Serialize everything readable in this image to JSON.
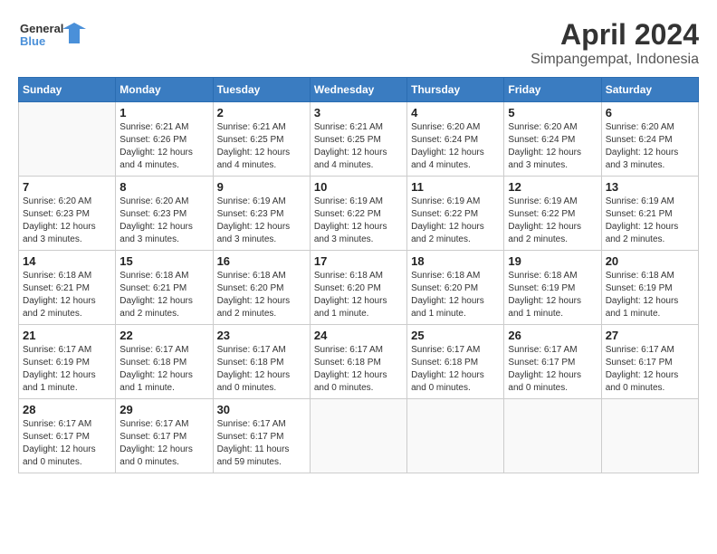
{
  "header": {
    "logo_line1": "General",
    "logo_line2": "Blue",
    "title": "April 2024",
    "subtitle": "Simpangempat, Indonesia"
  },
  "calendar": {
    "days_of_week": [
      "Sunday",
      "Monday",
      "Tuesday",
      "Wednesday",
      "Thursday",
      "Friday",
      "Saturday"
    ],
    "weeks": [
      [
        {
          "day": "",
          "info": ""
        },
        {
          "day": "1",
          "info": "Sunrise: 6:21 AM\nSunset: 6:26 PM\nDaylight: 12 hours\nand 4 minutes."
        },
        {
          "day": "2",
          "info": "Sunrise: 6:21 AM\nSunset: 6:25 PM\nDaylight: 12 hours\nand 4 minutes."
        },
        {
          "day": "3",
          "info": "Sunrise: 6:21 AM\nSunset: 6:25 PM\nDaylight: 12 hours\nand 4 minutes."
        },
        {
          "day": "4",
          "info": "Sunrise: 6:20 AM\nSunset: 6:24 PM\nDaylight: 12 hours\nand 4 minutes."
        },
        {
          "day": "5",
          "info": "Sunrise: 6:20 AM\nSunset: 6:24 PM\nDaylight: 12 hours\nand 3 minutes."
        },
        {
          "day": "6",
          "info": "Sunrise: 6:20 AM\nSunset: 6:24 PM\nDaylight: 12 hours\nand 3 minutes."
        }
      ],
      [
        {
          "day": "7",
          "info": "Sunrise: 6:20 AM\nSunset: 6:23 PM\nDaylight: 12 hours\nand 3 minutes."
        },
        {
          "day": "8",
          "info": "Sunrise: 6:20 AM\nSunset: 6:23 PM\nDaylight: 12 hours\nand 3 minutes."
        },
        {
          "day": "9",
          "info": "Sunrise: 6:19 AM\nSunset: 6:23 PM\nDaylight: 12 hours\nand 3 minutes."
        },
        {
          "day": "10",
          "info": "Sunrise: 6:19 AM\nSunset: 6:22 PM\nDaylight: 12 hours\nand 3 minutes."
        },
        {
          "day": "11",
          "info": "Sunrise: 6:19 AM\nSunset: 6:22 PM\nDaylight: 12 hours\nand 2 minutes."
        },
        {
          "day": "12",
          "info": "Sunrise: 6:19 AM\nSunset: 6:22 PM\nDaylight: 12 hours\nand 2 minutes."
        },
        {
          "day": "13",
          "info": "Sunrise: 6:19 AM\nSunset: 6:21 PM\nDaylight: 12 hours\nand 2 minutes."
        }
      ],
      [
        {
          "day": "14",
          "info": "Sunrise: 6:18 AM\nSunset: 6:21 PM\nDaylight: 12 hours\nand 2 minutes."
        },
        {
          "day": "15",
          "info": "Sunrise: 6:18 AM\nSunset: 6:21 PM\nDaylight: 12 hours\nand 2 minutes."
        },
        {
          "day": "16",
          "info": "Sunrise: 6:18 AM\nSunset: 6:20 PM\nDaylight: 12 hours\nand 2 minutes."
        },
        {
          "day": "17",
          "info": "Sunrise: 6:18 AM\nSunset: 6:20 PM\nDaylight: 12 hours\nand 1 minute."
        },
        {
          "day": "18",
          "info": "Sunrise: 6:18 AM\nSunset: 6:20 PM\nDaylight: 12 hours\nand 1 minute."
        },
        {
          "day": "19",
          "info": "Sunrise: 6:18 AM\nSunset: 6:19 PM\nDaylight: 12 hours\nand 1 minute."
        },
        {
          "day": "20",
          "info": "Sunrise: 6:18 AM\nSunset: 6:19 PM\nDaylight: 12 hours\nand 1 minute."
        }
      ],
      [
        {
          "day": "21",
          "info": "Sunrise: 6:17 AM\nSunset: 6:19 PM\nDaylight: 12 hours\nand 1 minute."
        },
        {
          "day": "22",
          "info": "Sunrise: 6:17 AM\nSunset: 6:18 PM\nDaylight: 12 hours\nand 1 minute."
        },
        {
          "day": "23",
          "info": "Sunrise: 6:17 AM\nSunset: 6:18 PM\nDaylight: 12 hours\nand 0 minutes."
        },
        {
          "day": "24",
          "info": "Sunrise: 6:17 AM\nSunset: 6:18 PM\nDaylight: 12 hours\nand 0 minutes."
        },
        {
          "day": "25",
          "info": "Sunrise: 6:17 AM\nSunset: 6:18 PM\nDaylight: 12 hours\nand 0 minutes."
        },
        {
          "day": "26",
          "info": "Sunrise: 6:17 AM\nSunset: 6:17 PM\nDaylight: 12 hours\nand 0 minutes."
        },
        {
          "day": "27",
          "info": "Sunrise: 6:17 AM\nSunset: 6:17 PM\nDaylight: 12 hours\nand 0 minutes."
        }
      ],
      [
        {
          "day": "28",
          "info": "Sunrise: 6:17 AM\nSunset: 6:17 PM\nDaylight: 12 hours\nand 0 minutes."
        },
        {
          "day": "29",
          "info": "Sunrise: 6:17 AM\nSunset: 6:17 PM\nDaylight: 12 hours\nand 0 minutes."
        },
        {
          "day": "30",
          "info": "Sunrise: 6:17 AM\nSunset: 6:17 PM\nDaylight: 11 hours\nand 59 minutes."
        },
        {
          "day": "",
          "info": ""
        },
        {
          "day": "",
          "info": ""
        },
        {
          "day": "",
          "info": ""
        },
        {
          "day": "",
          "info": ""
        }
      ]
    ]
  }
}
